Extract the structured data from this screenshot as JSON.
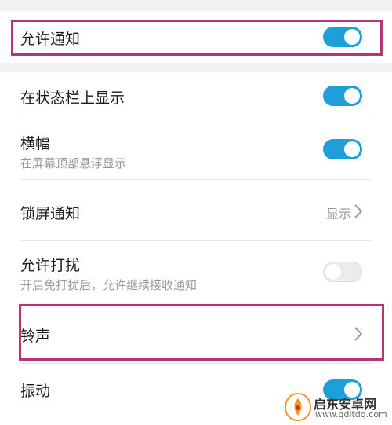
{
  "settings": {
    "allow_notifications": {
      "label": "允许通知",
      "enabled": true
    },
    "status_bar": {
      "label": "在状态栏上显示",
      "enabled": true
    },
    "banner": {
      "label": "横幅",
      "subtitle": "在屏幕顶部悬浮显示",
      "enabled": true
    },
    "lock_screen": {
      "label": "锁屏通知",
      "value": "显示"
    },
    "dnd": {
      "label": "允许打扰",
      "subtitle": "开启免打扰后，允许继续接收通知",
      "enabled": false
    },
    "ringtone": {
      "label": "铃声"
    },
    "vibration": {
      "label": "振动",
      "enabled": true
    }
  },
  "watermark": {
    "name": "启东安卓网",
    "url": "www.qdltdq.com"
  },
  "colors": {
    "accent": "#1e9fd9",
    "highlight": "#b8327a",
    "background": "#f2f2f2"
  }
}
